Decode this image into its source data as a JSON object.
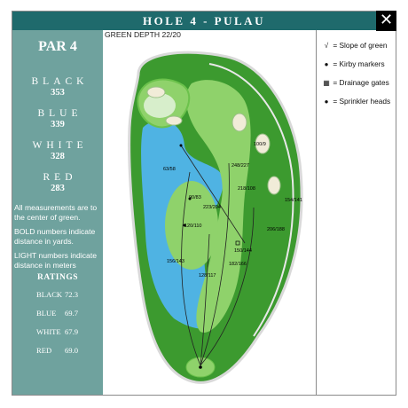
{
  "header": {
    "title": "HOLE 4 - PULAU",
    "close_label": "✕"
  },
  "sidebar": {
    "par": "PAR 4",
    "tees": [
      {
        "name": "BLACK",
        "yards": "353"
      },
      {
        "name": "BLUE",
        "yards": "339"
      },
      {
        "name": "WHITE",
        "yards": "328"
      },
      {
        "name": "RED",
        "yards": "283"
      }
    ],
    "notes": [
      "All measurements are to the center of green.",
      "BOLD numbers indicate distance in yards.",
      "LIGHT numbers indicate distance in meters"
    ],
    "ratings_title": "RATINGS",
    "ratings": [
      {
        "tee": "BLACK",
        "value": "72.3"
      },
      {
        "tee": "BLUE",
        "value": "69.7"
      },
      {
        "tee": "WHITE",
        "value": "67.9"
      },
      {
        "tee": "RED",
        "value": "69.0"
      }
    ]
  },
  "map": {
    "green_depth": "GREEN DEPTH 22/20",
    "distances": [
      "63/58",
      "90/83",
      "223/204",
      "120/110",
      "156/143",
      "128/117",
      "182/166",
      "150/144",
      "218/108",
      "248/227",
      "100/9",
      "154/141",
      "206/188"
    ],
    "colors": {
      "water": "#4fb3e3",
      "rough": "#3c9a2f",
      "fairway": "#8fd26b",
      "sand": "#f1ecd8"
    }
  },
  "legend": [
    {
      "icon": "slope-icon",
      "symbol": "√",
      "label": "= Slope of green"
    },
    {
      "icon": "kirby-marker-icon",
      "symbol": "●",
      "label": "= Kirby markers"
    },
    {
      "icon": "drainage-gate-icon",
      "symbol": "▦",
      "label": "= Drainage gates"
    },
    {
      "icon": "sprinkler-head-icon",
      "symbol": "●",
      "label": "= Sprinkler heads"
    }
  ]
}
